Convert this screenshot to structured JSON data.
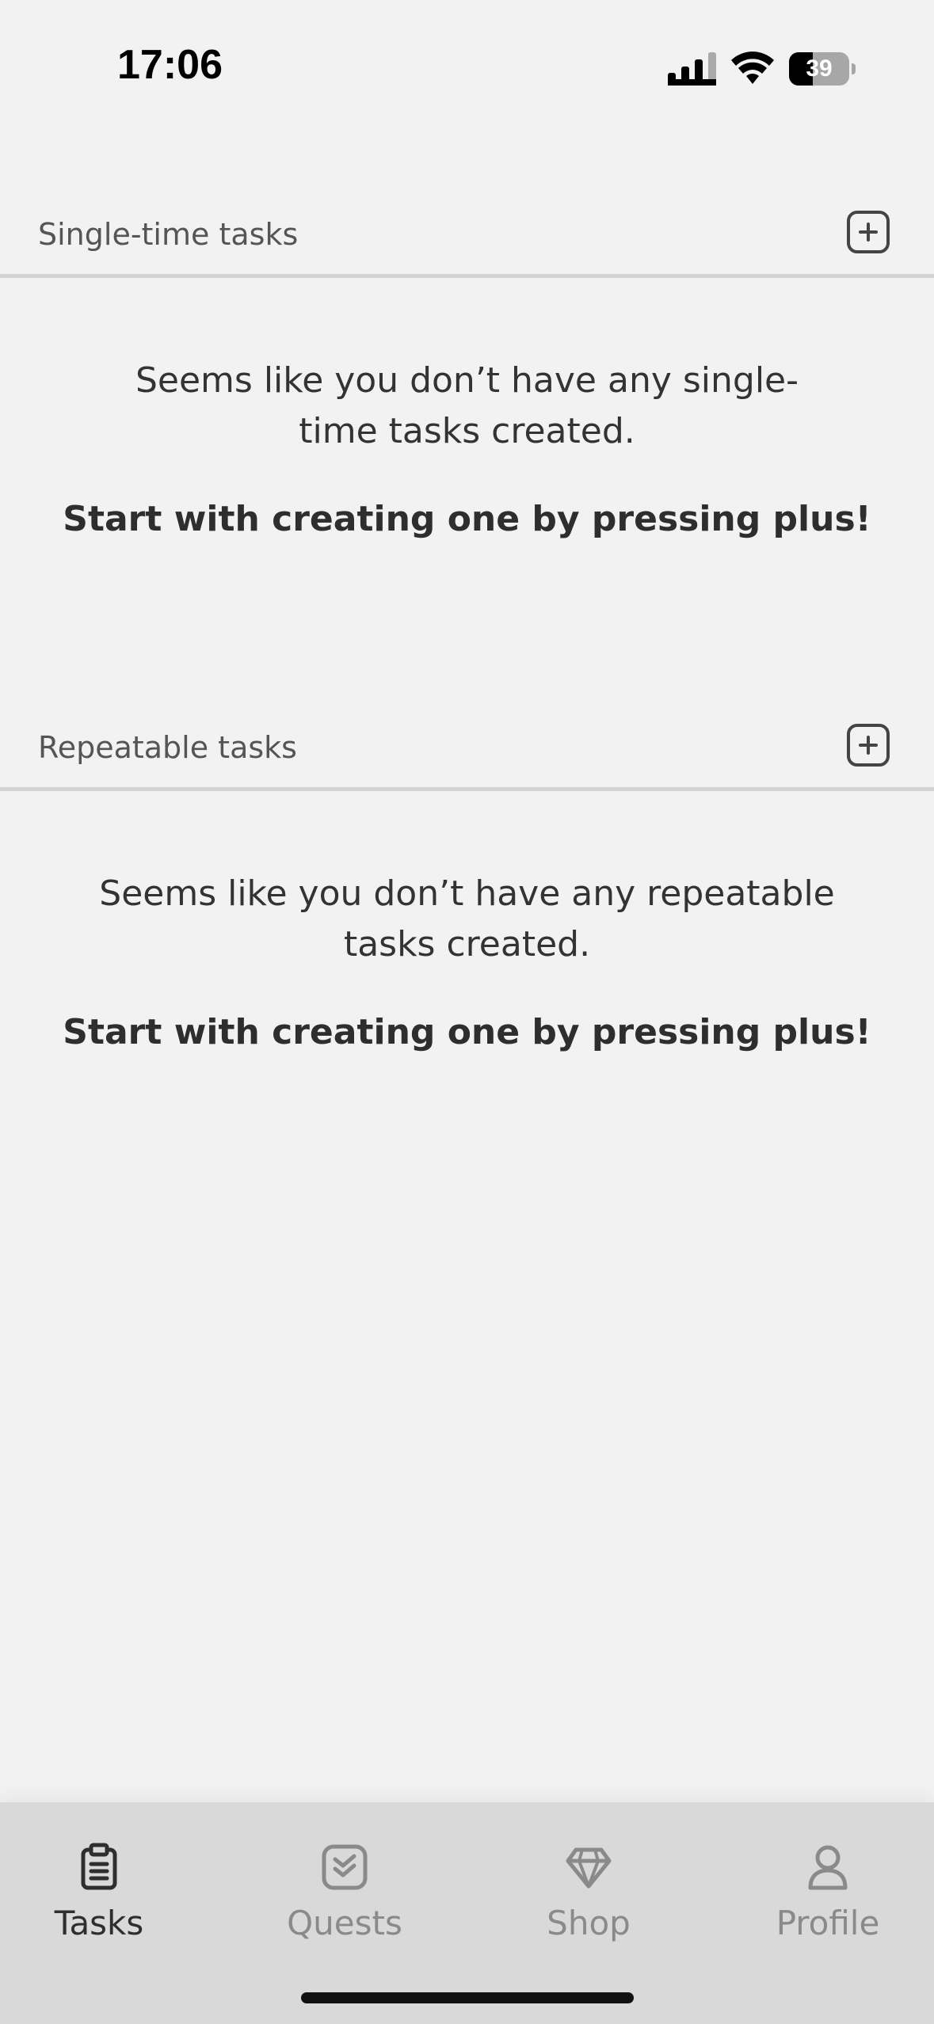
{
  "status_bar": {
    "time": "17:06",
    "battery": 39,
    "battery_label": "39"
  },
  "sections": [
    {
      "title": "Single-time tasks",
      "empty_message": "Seems like you don’t have any single-time tasks created.",
      "empty_message_line1": "Seems like you don’t have any single-",
      "empty_message_line2": "time tasks created.",
      "cta": "Start with creating one by pressing plus!",
      "add_icon": "plus-square-icon"
    },
    {
      "title": "Repeatable tasks",
      "empty_message": "Seems like you don’t have any repeatable tasks created.",
      "empty_message_line1": "Seems like you don’t have any repeatable",
      "empty_message_line2": "tasks created.",
      "cta": "Start with creating one by pressing plus!",
      "add_icon": "plus-square-icon"
    }
  ],
  "tab_bar": {
    "active": "Tasks",
    "tabs": [
      {
        "label": "Tasks",
        "icon": "clipboard-icon"
      },
      {
        "label": "Quests",
        "icon": "check-square-icon"
      },
      {
        "label": "Shop",
        "icon": "diamond-icon"
      },
      {
        "label": "Profile",
        "icon": "user-icon"
      }
    ]
  },
  "colors": {
    "background": "#f2f2f2",
    "tab_bar": "#d9d9d9",
    "text": "#2e2e2e",
    "muted": "#8a8a8a",
    "divider": "#d3d3d3"
  }
}
